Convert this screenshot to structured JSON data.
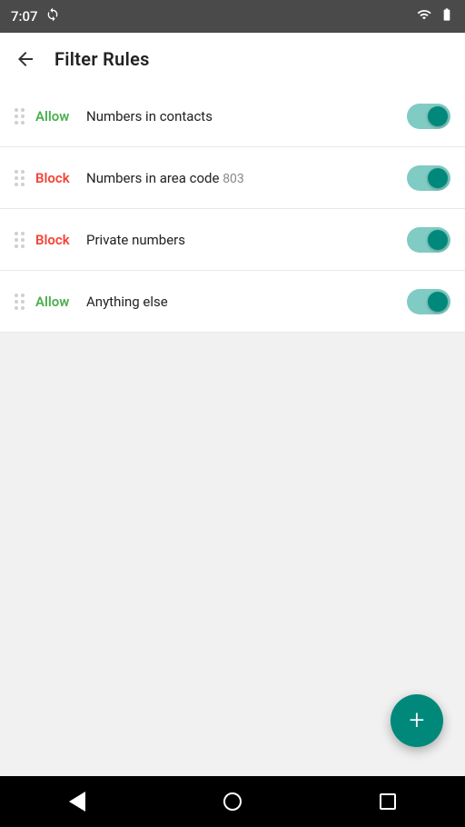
{
  "statusBar": {
    "time": "7:07",
    "icons": [
      "sync-icon",
      "wifi-icon",
      "battery-icon"
    ]
  },
  "header": {
    "back_label": "←",
    "title": "Filter Rules"
  },
  "rules": [
    {
      "id": "rule-1",
      "action": "Allow",
      "actionClass": "allow",
      "description": "Numbers in contacts",
      "areaCode": "",
      "enabled": true
    },
    {
      "id": "rule-2",
      "action": "Block",
      "actionClass": "block",
      "description": "Numbers in area code",
      "areaCode": "803",
      "enabled": true
    },
    {
      "id": "rule-3",
      "action": "Block",
      "actionClass": "block",
      "description": "Private numbers",
      "areaCode": "",
      "enabled": true
    },
    {
      "id": "rule-4",
      "action": "Allow",
      "actionClass": "allow",
      "description": "Anything else",
      "areaCode": "",
      "enabled": true
    }
  ],
  "fab": {
    "label": "+",
    "aria": "Add filter rule"
  },
  "navBar": {
    "back": "back",
    "home": "home",
    "recents": "recents"
  }
}
